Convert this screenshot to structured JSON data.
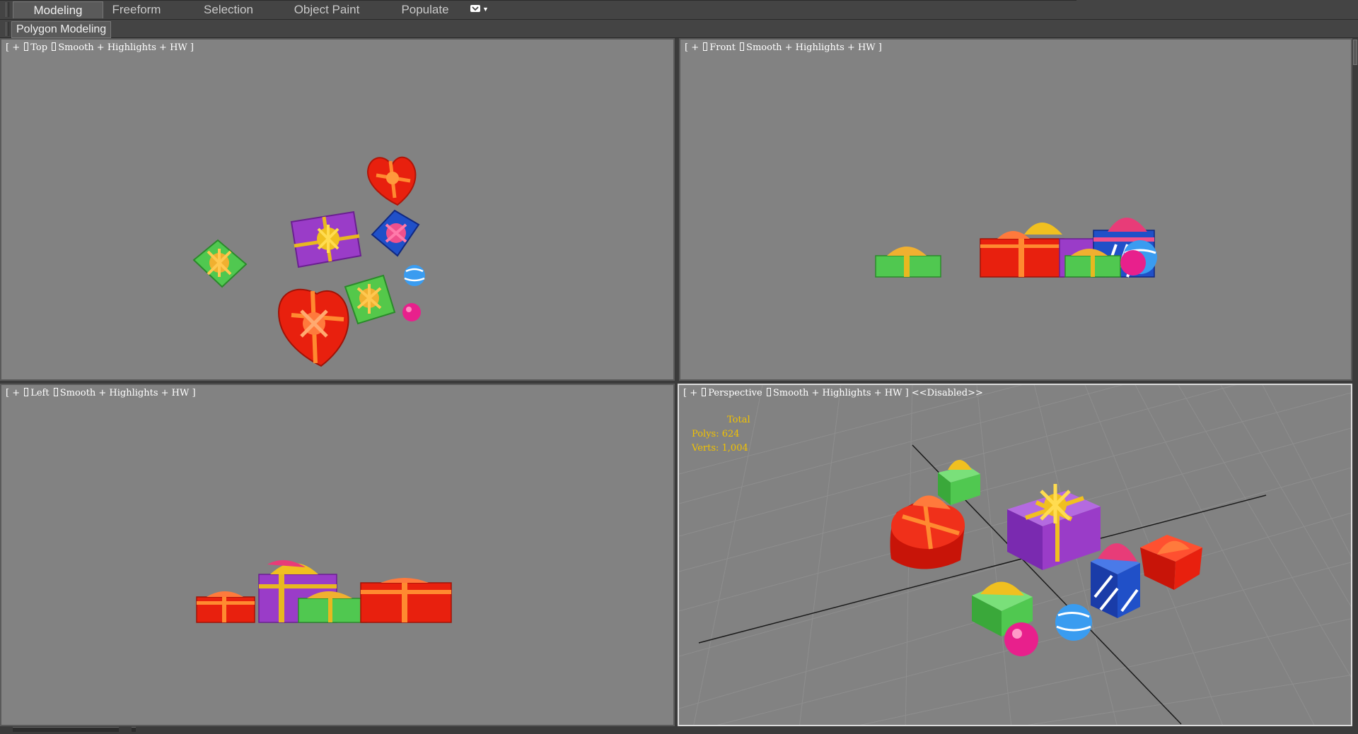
{
  "ribbon": {
    "tabs": [
      {
        "label": "Modeling",
        "active": true
      },
      {
        "label": "Freeform",
        "active": false
      },
      {
        "label": "Selection",
        "active": false
      },
      {
        "label": "Object Paint",
        "active": false
      },
      {
        "label": "Populate",
        "active": false
      }
    ],
    "options_icon": "ribbon-options-icon",
    "panel_label": "Polygon Modeling"
  },
  "viewports": {
    "top": {
      "view": "Top",
      "shading": "Smooth + Highlights + HW"
    },
    "front": {
      "view": "Front",
      "shading": "Smooth + Highlights + HW"
    },
    "left": {
      "view": "Left",
      "shading": "Smooth + Highlights + HW"
    },
    "perspective": {
      "view": "Perspective",
      "shading": "Smooth + Highlights + HW",
      "suffix": "<<Disabled>>"
    }
  },
  "stats": {
    "title": "Total",
    "polys_label": "Polys:",
    "polys": "624",
    "verts_label": "Verts:",
    "verts": "1,004"
  },
  "colors": {
    "viewport_bg": "#828282",
    "ui_bg": "#444444",
    "stats_text": "#f2c200",
    "active_border": "#dcdcdc"
  }
}
